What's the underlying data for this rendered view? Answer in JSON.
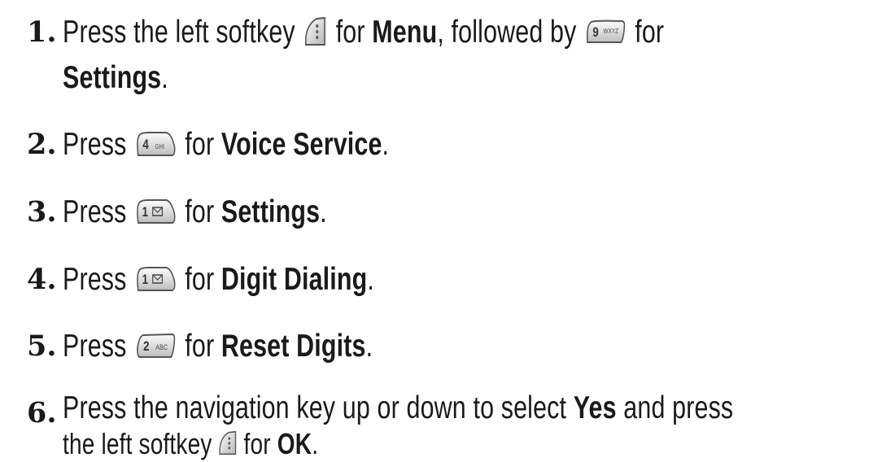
{
  "steps": [
    {
      "number": "1.",
      "text_a": "Press the left softkey",
      "text_b": "for",
      "bold_1": "Menu",
      "text_c": ", followed by",
      "text_d": "for",
      "bold_2": "Settings",
      "end": "."
    },
    {
      "number": "2.",
      "text_a": "Press",
      "key": {
        "digit": "4",
        "letters": "GHI"
      },
      "text_b": "for",
      "bold": "Voice Service",
      "end": "."
    },
    {
      "number": "3.",
      "text_a": "Press",
      "key": {
        "digit": "1",
        "letters": "✉"
      },
      "text_b": "for",
      "bold": "Settings",
      "end": "."
    },
    {
      "number": "4.",
      "text_a": "Press",
      "key": {
        "digit": "1",
        "letters": "✉"
      },
      "text_b": "for",
      "bold": "Digit Dialing",
      "end": "."
    },
    {
      "number": "5.",
      "text_a": "Press",
      "key": {
        "digit": "2",
        "letters": "ABC"
      },
      "text_b": "for",
      "bold": "Reset Digits",
      "end": "."
    },
    {
      "number": "6.",
      "text_a": "Press the navigation key up or down to select",
      "bold_1": "Yes",
      "text_b": "and press",
      "text_c": "the left softkey",
      "text_d": "for",
      "bold_2": "OK",
      "end": "."
    }
  ],
  "keys": {
    "key_9": {
      "digit": "9",
      "letters": "WXYZ"
    }
  }
}
